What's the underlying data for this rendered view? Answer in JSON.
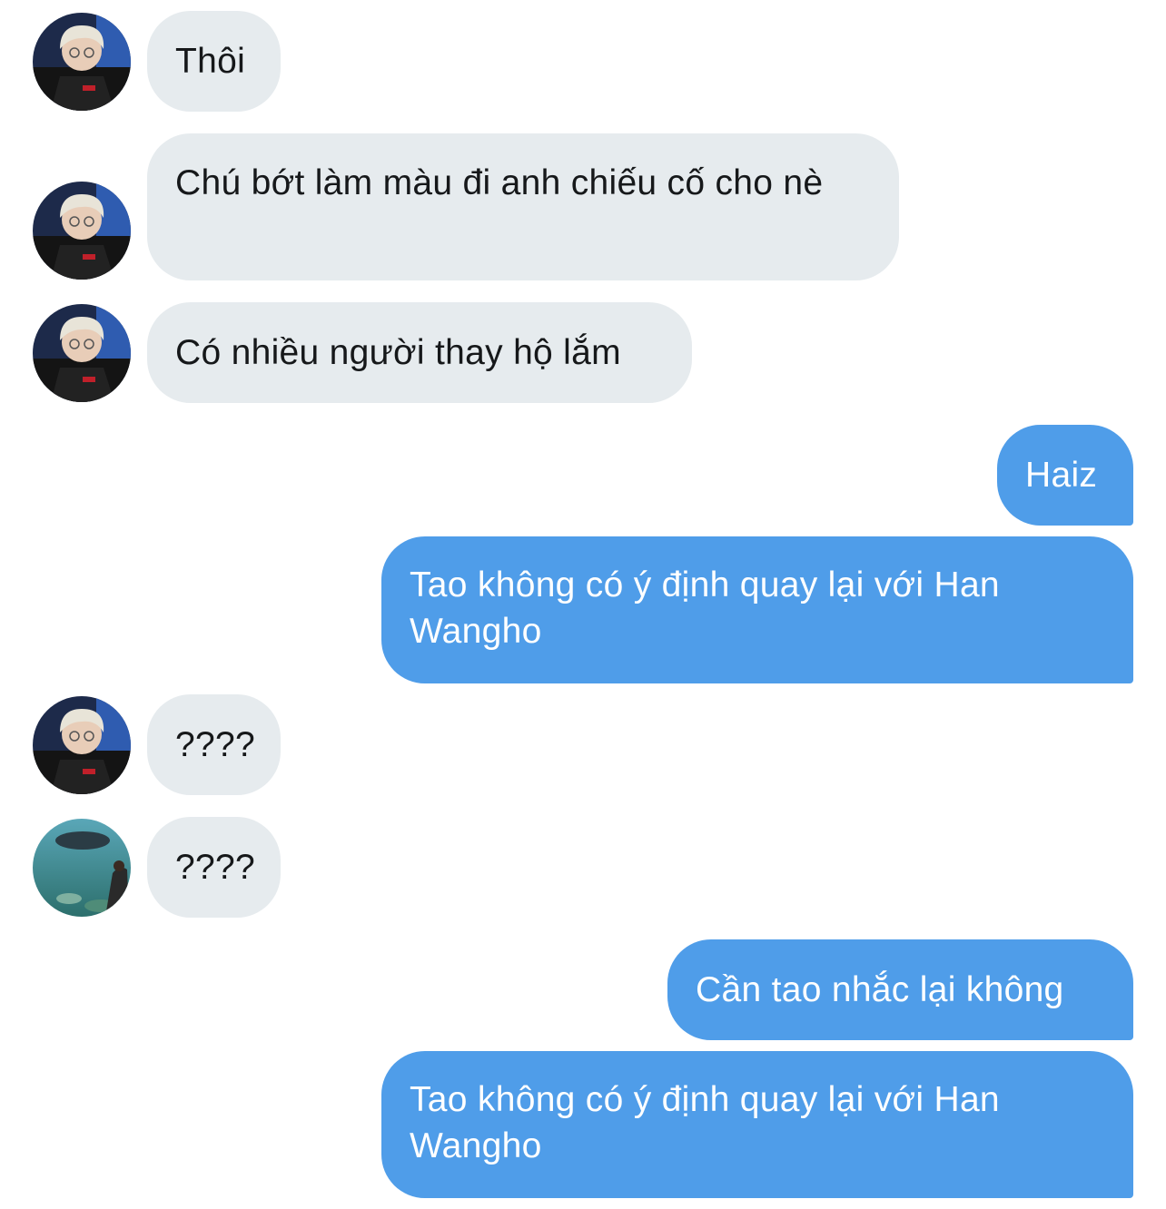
{
  "messages": [
    {
      "side": "in",
      "avatar": "avatar-person",
      "text": "Thôi"
    },
    {
      "side": "in",
      "avatar": "avatar-person",
      "text": "Chú bớt làm màu đi anh chiếu cố cho nè"
    },
    {
      "side": "in",
      "avatar": "avatar-person",
      "text": "Có nhiều người thay hộ lắm"
    },
    {
      "side": "out",
      "text": "Haiz"
    },
    {
      "side": "out",
      "text": "Tao không có ý định quay lại với Han Wangho"
    },
    {
      "side": "in",
      "avatar": "avatar-person",
      "text": "????"
    },
    {
      "side": "in",
      "avatar": "avatar-aquarium",
      "text": "????"
    },
    {
      "side": "out",
      "text": "Cần tao nhắc lại không"
    },
    {
      "side": "out",
      "text": "Tao không có ý định quay lại với Han Wangho"
    }
  ],
  "colors": {
    "incoming_bubble": "#e6ebee",
    "outgoing_bubble": "#4f9de9",
    "incoming_text": "#16181a",
    "outgoing_text": "#ffffff"
  }
}
